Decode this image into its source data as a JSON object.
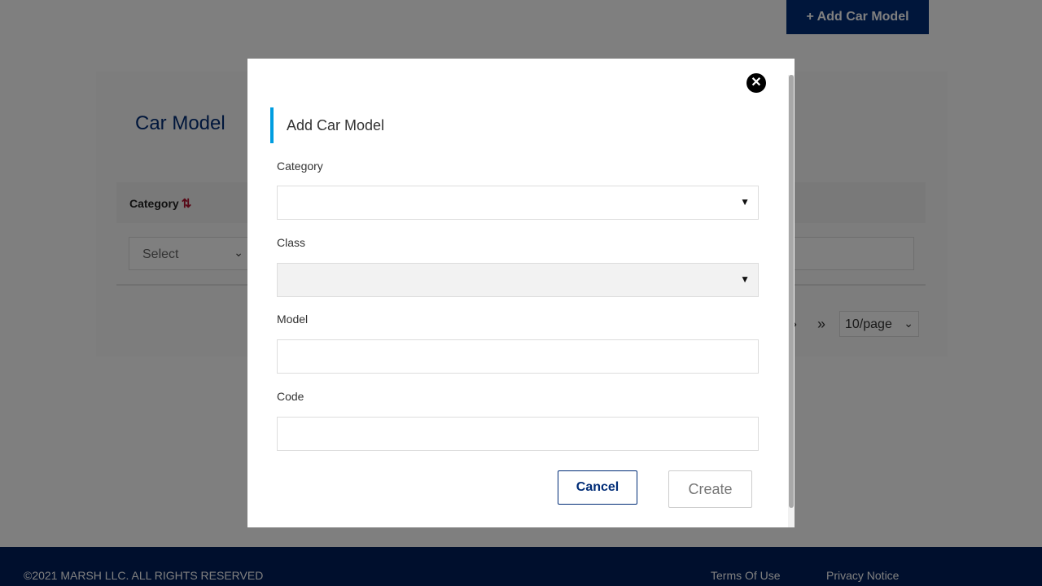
{
  "header": {
    "add_button_label": "+ Add Car Model"
  },
  "card": {
    "title": "Car Model",
    "columns": [
      {
        "label": "Category",
        "sort_icon": "sort-icon"
      }
    ],
    "category_filter": {
      "value": "Select"
    },
    "pagination": {
      "next": "›",
      "last": "»",
      "page_size": "10/page"
    }
  },
  "modal": {
    "title": "Add Car Model",
    "close_icon": "close-icon",
    "fields": {
      "category": {
        "label": "Category",
        "value": ""
      },
      "class": {
        "label": "Class",
        "value": ""
      },
      "model": {
        "label": "Model",
        "value": ""
      },
      "code": {
        "label": "Code",
        "value": ""
      }
    },
    "cancel_label": "Cancel",
    "create_label": "Create"
  },
  "footer": {
    "copyright": "©2021 MARSH LLC. ALL RIGHTS RESERVED",
    "terms": "Terms Of Use",
    "privacy": "Privacy Notice"
  },
  "colors": {
    "brand": "#002c77",
    "accent": "#009de0",
    "footer": "#001f5b"
  }
}
